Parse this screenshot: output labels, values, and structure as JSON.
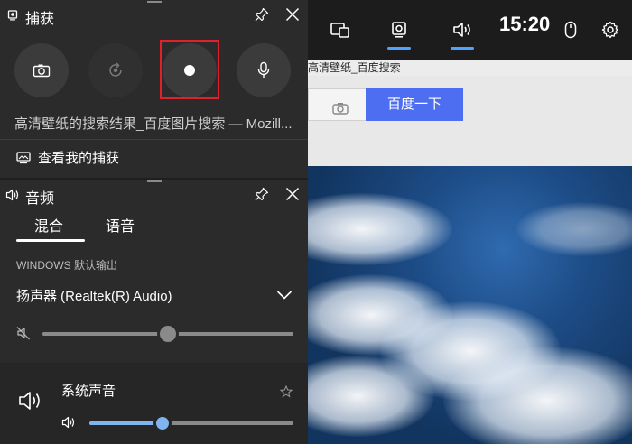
{
  "browser": {
    "url_fragment": "高清壁纸_百度搜索",
    "search_button_label": "百度一下"
  },
  "topbar": {
    "clock": "15:20",
    "buttons": [
      {
        "icon": "widget-menu-icon",
        "active": false
      },
      {
        "icon": "capture-widget-icon",
        "active": true
      },
      {
        "icon": "audio-widget-icon",
        "active": true
      },
      {
        "icon": "mouse-icon",
        "active": false
      },
      {
        "icon": "settings-gear-icon",
        "active": false
      }
    ]
  },
  "capture_panel": {
    "title": "捕获",
    "window_title": "高清壁纸的搜索结果_百度图片搜索 — Mozill...",
    "view_captures_label": "查看我的捕获",
    "buttons": [
      {
        "icon": "screenshot-camera-icon"
      },
      {
        "icon": "record-last-30s-icon"
      },
      {
        "icon": "start-recording-icon",
        "highlighted": true
      },
      {
        "icon": "microphone-icon"
      }
    ]
  },
  "audio_panel": {
    "title": "音频",
    "tabs": [
      {
        "label": "混合",
        "selected": true
      },
      {
        "label": "语音",
        "selected": false
      }
    ],
    "output_section_label": "WINDOWS 默认输出",
    "output_device": "扬声器 (Realtek(R) Audio)",
    "master_volume_fraction": 0.5,
    "master_muted": true,
    "app": {
      "name": "系统声音",
      "volume_fraction": 0.36
    },
    "accent_color": "#7fb4f0"
  }
}
